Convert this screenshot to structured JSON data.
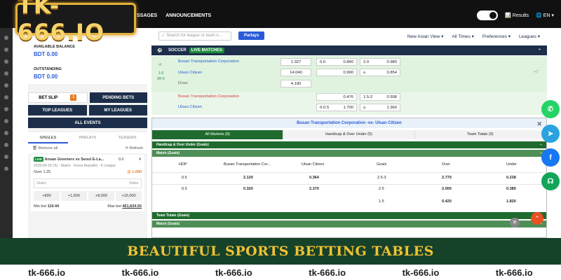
{
  "topnav": {
    "item1": "SSAGES",
    "item2": "ANNOUNCEMENTS"
  },
  "topright": {
    "results": "Results",
    "lang": "EN"
  },
  "logo": {
    "text": "TK-666.IO"
  },
  "left": {
    "available_label": "AVAILABLE BALANCE",
    "available_value": "BDT 0.00",
    "outstanding_label": "OUTSTANDING",
    "outstanding_value": "BDT 0.00",
    "bet_slip": "BET SLIP",
    "bet_slip_badge": "1",
    "pending": "PENDING BETS",
    "top_leagues": "TOP LEAGUES",
    "my_leagues": "MY LEAGUES",
    "all_events": "ALL EVENTS",
    "tabs": [
      "SINGLES",
      "PARLAYS",
      "TEASERS"
    ],
    "remove_all": "Remove all",
    "refresh": "Refresh",
    "bet": {
      "live": "LIVE",
      "match": "Ansan Greeners vs Seoul E-La...",
      "odds": "0.0",
      "meta": "2026-04-19 OU · Match · Korea Republic · K League",
      "line": "Over 1.25",
      "price": "@ 1.000",
      "stake_label": "Stake",
      "stake_right": "Stake",
      "chips": [
        "+800",
        "+1,600",
        "+8,000",
        "+16,000"
      ],
      "min_label": "Min bet",
      "min_value": "119.44",
      "max_label": "Max bet",
      "max_value": "461,834.93"
    }
  },
  "main": {
    "search_placeholder": "Search for league or team n...",
    "parlays": "Parlays",
    "filters": [
      "New Asian View ▾",
      "All Times ▾",
      "Preferences ▾",
      "Leagues ▾"
    ],
    "soccer": "SOCCER",
    "live_matches": "LIVE MATCHES",
    "m1": {
      "team1": "Busan Transportation Corporation",
      "team2": "Ulsan Citizen",
      "draw": "Draw",
      "score": "1-0",
      "time": "2H 0",
      "ml": [
        "1.327",
        "14.040",
        "4.190"
      ],
      "h": [
        "0.0",
        "0.840",
        "0.990"
      ],
      "ou": [
        "2.0",
        "0.980",
        "u",
        "0.854"
      ],
      "more": "+7"
    },
    "m2": {
      "team1": "Busan Transportation Corporation",
      "team2": "Ulsan Citizen",
      "h": [
        "0.476",
        "0-0.5",
        "1.700"
      ],
      "ou": [
        "1.5-2",
        "0.598",
        "u",
        "1.360"
      ]
    }
  },
  "popup": {
    "title": "Busan Transportation Corporation -vs- Ulsan Citizen",
    "tabs": [
      "All Markets (8)",
      "Handicap & Over Under (5)",
      "Team Totals (3)"
    ],
    "g1": "Handicap & Over Under (Goals)",
    "g1sub": "Match (Goals)",
    "headers": [
      "HDP",
      "Busan Transportation Cor...",
      "Ulsan Citizen",
      "Goals",
      "Over",
      "Under"
    ],
    "rows": [
      [
        "0.5",
        "2.120",
        "0.364",
        "2.5-3",
        "2.770",
        "0.238"
      ],
      [
        "0.5",
        "0.320",
        "2.370",
        "2.5",
        "2.000",
        "0.380"
      ],
      [
        "",
        "",
        "",
        "1.5",
        "0.420",
        "1.820"
      ]
    ],
    "g2": "Team Totals (Goals)",
    "g2sub": "Match (Goals)"
  },
  "footer": {
    "banner": "BEAUTIFUL SPORTS BETTING TABLES",
    "wm": [
      "tk-666.io",
      "tk-666.io",
      "tk-666.io",
      "tk-666.io",
      "tk-666.io",
      "tk-666.io"
    ]
  },
  "colors": {
    "navy": "#1c2e4a",
    "green": "#1f6b2e",
    "gold": "#f1c232",
    "footer": "#16422a"
  }
}
